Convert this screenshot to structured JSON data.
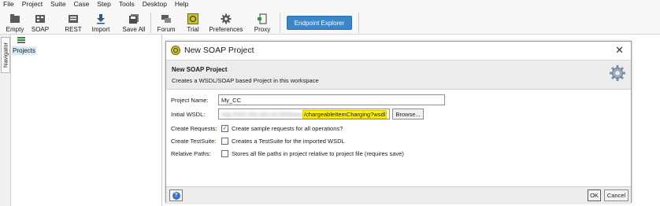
{
  "menu": [
    "File",
    "Project",
    "Suite",
    "Case",
    "Step",
    "Tools",
    "Desktop",
    "Help"
  ],
  "toolbar": {
    "empty": "Empty",
    "soap": "SOAP",
    "rest": "REST",
    "import": "Import",
    "save_all": "Save All",
    "forum": "Forum",
    "trial": "Trial",
    "preferences": "Preferences",
    "proxy": "Proxy",
    "endpoint_explorer": "Endpoint Explorer"
  },
  "navigator": {
    "tab_label": "Navigator",
    "root": "Projects"
  },
  "dialog": {
    "title": "New SOAP Project",
    "header_title": "New SOAP Project",
    "header_subtitle": "Creates a WSDL/SOAP based Project in this workspace",
    "project_name_label": "Project Name:",
    "project_name_value": "My_CC",
    "initial_wsdl_label": "Initial WSDL:",
    "initial_wsdl_value_visible": "/chargeableItemCharging?wsdl",
    "browse": "Browse...",
    "create_requests_label": "Create Requests:",
    "create_requests_text": "Create sample requests for all operations?",
    "create_requests_checked": true,
    "create_testsuite_label": "Create TestSuite:",
    "create_testsuite_text": "Creates a TestSuite for the imported WSDL",
    "create_testsuite_checked": false,
    "relative_paths_label": "Relative Paths:",
    "relative_paths_text": "Stores all file paths in project relative to project file (requires save)",
    "relative_paths_checked": false,
    "ok": "OK",
    "cancel": "Cancel"
  },
  "colors": {
    "accent": "#3a86c8",
    "highlight": "#fff200"
  }
}
